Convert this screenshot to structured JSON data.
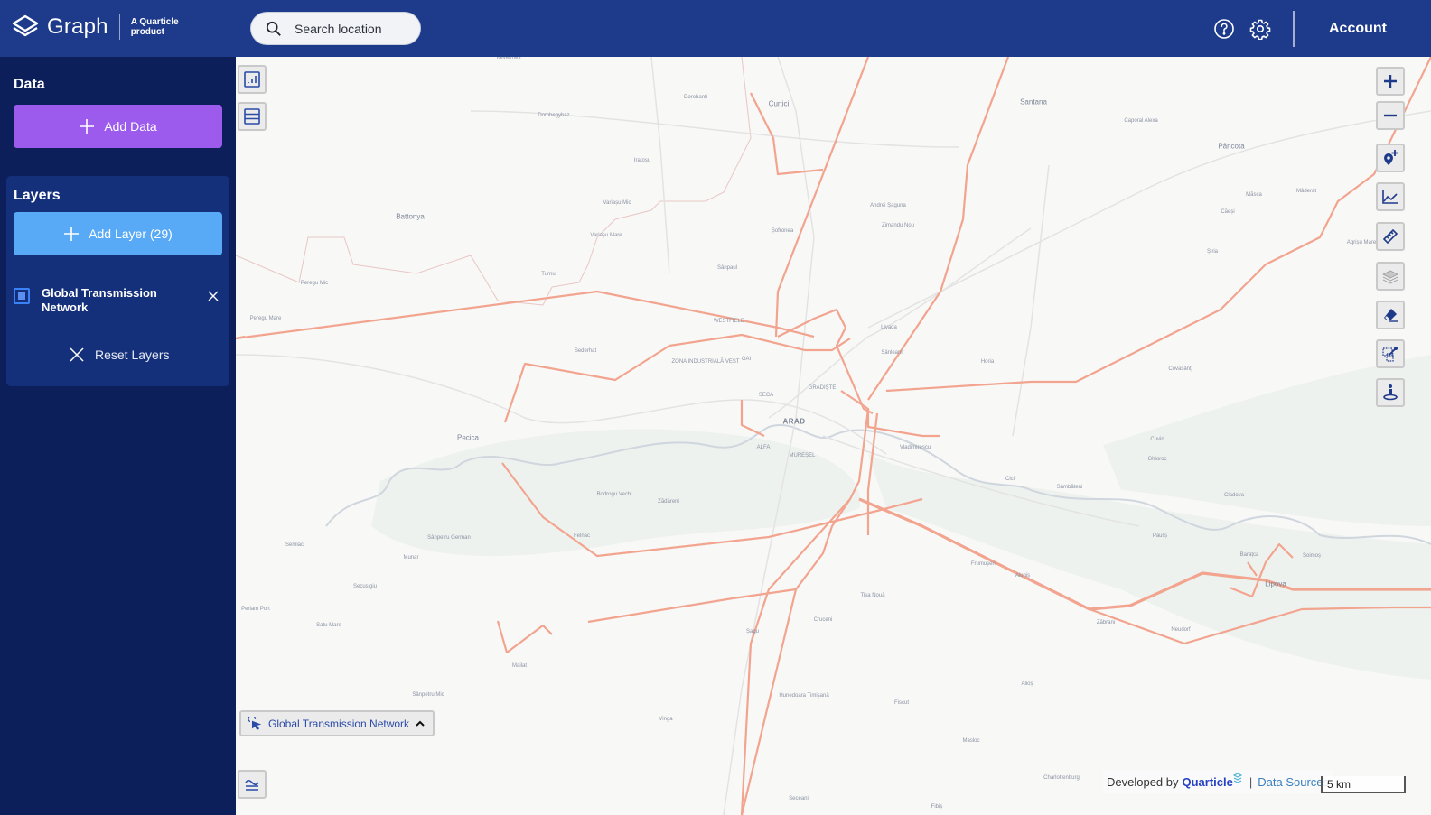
{
  "header": {
    "app_name": "Graph",
    "tagline_line1": "A Quarticle",
    "tagline_line2": "product",
    "search_placeholder": "Search location",
    "icons": [
      "help-icon",
      "settings-gear-icon"
    ],
    "account_label": "Account"
  },
  "sidebar": {
    "data_title": "Data",
    "add_data_label": "Add Data",
    "layers_title": "Layers",
    "add_layer_label": "Add Layer (29)",
    "layers": [
      {
        "name": "Global Transmission Network",
        "checked": true
      }
    ],
    "reset_label": "Reset Layers"
  },
  "map": {
    "left_controls": [
      "chart-panel-icon",
      "table-list-icon"
    ],
    "right_controls": [
      "zoom-in-icon",
      "zoom-out-icon",
      "add-marker-icon",
      "line-chart-icon",
      "ruler-icon",
      "layers-icon",
      "eraser-icon",
      "select-area-icon",
      "street-view-icon"
    ],
    "active_layer_label": "Global Transmission Network",
    "legend_toggle_icon": "legend-icon",
    "attribution_prefix": "Developed by",
    "attribution_brand": "Quarticle",
    "data_sources_label": "Data Sources",
    "scale_label": "5 km",
    "colors": {
      "transmission_line": "#f2a48f",
      "background": "#f8f8f7",
      "accent": "#1e3a8a"
    },
    "labels": [
      {
        "text": "ARAD",
        "kind": "city"
      },
      {
        "text": "Curtici",
        "kind": "big"
      },
      {
        "text": "Santana",
        "kind": "big"
      },
      {
        "text": "Pâncota",
        "kind": "big"
      },
      {
        "text": "Battonya",
        "kind": "big"
      },
      {
        "text": "Pecica",
        "kind": "big"
      },
      {
        "text": "Lipova",
        "kind": "big"
      },
      {
        "text": "Dombegyház",
        "kind": "small"
      },
      {
        "text": "Dorobanți",
        "kind": "small"
      },
      {
        "text": "Iratoșu",
        "kind": "small"
      },
      {
        "text": "Variașu Mic",
        "kind": "small"
      },
      {
        "text": "Variașu Mare",
        "kind": "small"
      },
      {
        "text": "Turnu",
        "kind": "small"
      },
      {
        "text": "Peregu Mic",
        "kind": "small"
      },
      {
        "text": "Peregu Mare",
        "kind": "small"
      },
      {
        "text": "Sederhat",
        "kind": "small"
      },
      {
        "text": "ZONA INDUSTRIALĂ VEST",
        "kind": "small"
      },
      {
        "text": "Caporal Alexa",
        "kind": "small"
      },
      {
        "text": "Andrei Șaguna",
        "kind": "small"
      },
      {
        "text": "Zimandu Nou",
        "kind": "small"
      },
      {
        "text": "Șofronea",
        "kind": "small"
      },
      {
        "text": "Sânpaul",
        "kind": "small"
      },
      {
        "text": "WESTFIELD",
        "kind": "small"
      },
      {
        "text": "Livada",
        "kind": "small"
      },
      {
        "text": "Sânleani",
        "kind": "small"
      },
      {
        "text": "GAI",
        "kind": "small"
      },
      {
        "text": "GRĂDIȘTE",
        "kind": "small"
      },
      {
        "text": "SECA",
        "kind": "small"
      },
      {
        "text": "Vladimirescu",
        "kind": "small"
      },
      {
        "text": "ALFA",
        "kind": "small"
      },
      {
        "text": "MUREȘEL",
        "kind": "small"
      },
      {
        "text": "Măsca",
        "kind": "small"
      },
      {
        "text": "Căeși",
        "kind": "small"
      },
      {
        "text": "Șiria",
        "kind": "small"
      },
      {
        "text": "Mâderat",
        "kind": "small"
      },
      {
        "text": "Agrișu Mare",
        "kind": "small"
      },
      {
        "text": "Horia",
        "kind": "small"
      },
      {
        "text": "Covăsânț",
        "kind": "small"
      },
      {
        "text": "Cuvin",
        "kind": "small"
      },
      {
        "text": "Ghioroc",
        "kind": "small"
      },
      {
        "text": "Cicir",
        "kind": "small"
      },
      {
        "text": "Sâmbăteni",
        "kind": "small"
      },
      {
        "text": "Cladova",
        "kind": "small"
      },
      {
        "text": "Păuliș",
        "kind": "small"
      },
      {
        "text": "Barațca",
        "kind": "small"
      },
      {
        "text": "Șoimoș",
        "kind": "small"
      },
      {
        "text": "Frumușeni",
        "kind": "small"
      },
      {
        "text": "Aluniș",
        "kind": "small"
      },
      {
        "text": "Zăbrani",
        "kind": "small"
      },
      {
        "text": "Neudorf",
        "kind": "small"
      },
      {
        "text": "Bodrogu Vechi",
        "kind": "small"
      },
      {
        "text": "Zădăreni",
        "kind": "small"
      },
      {
        "text": "Felnac",
        "kind": "small"
      },
      {
        "text": "Sânpetru German",
        "kind": "small"
      },
      {
        "text": "Munar",
        "kind": "small"
      },
      {
        "text": "Semlac",
        "kind": "small"
      },
      {
        "text": "Secusigiu",
        "kind": "small"
      },
      {
        "text": "Periam Port",
        "kind": "small"
      },
      {
        "text": "Satu Mare",
        "kind": "small"
      },
      {
        "text": "Tisa Nouă",
        "kind": "small"
      },
      {
        "text": "Cruceni",
        "kind": "small"
      },
      {
        "text": "Șagu",
        "kind": "small"
      },
      {
        "text": "Hunedoara Timișană",
        "kind": "small"
      },
      {
        "text": "Fiscut",
        "kind": "small"
      },
      {
        "text": "Vinga",
        "kind": "small"
      },
      {
        "text": "Alioș",
        "kind": "small"
      },
      {
        "text": "Masloc",
        "kind": "small"
      },
      {
        "text": "Charlottenburg",
        "kind": "small"
      },
      {
        "text": "Seceani",
        "kind": "small"
      },
      {
        "text": "Fibiș",
        "kind": "small"
      },
      {
        "text": "Mailat",
        "kind": "small"
      },
      {
        "text": "Sânpetru Mic",
        "kind": "small"
      },
      {
        "text": "Kevermes",
        "kind": "small"
      }
    ]
  }
}
